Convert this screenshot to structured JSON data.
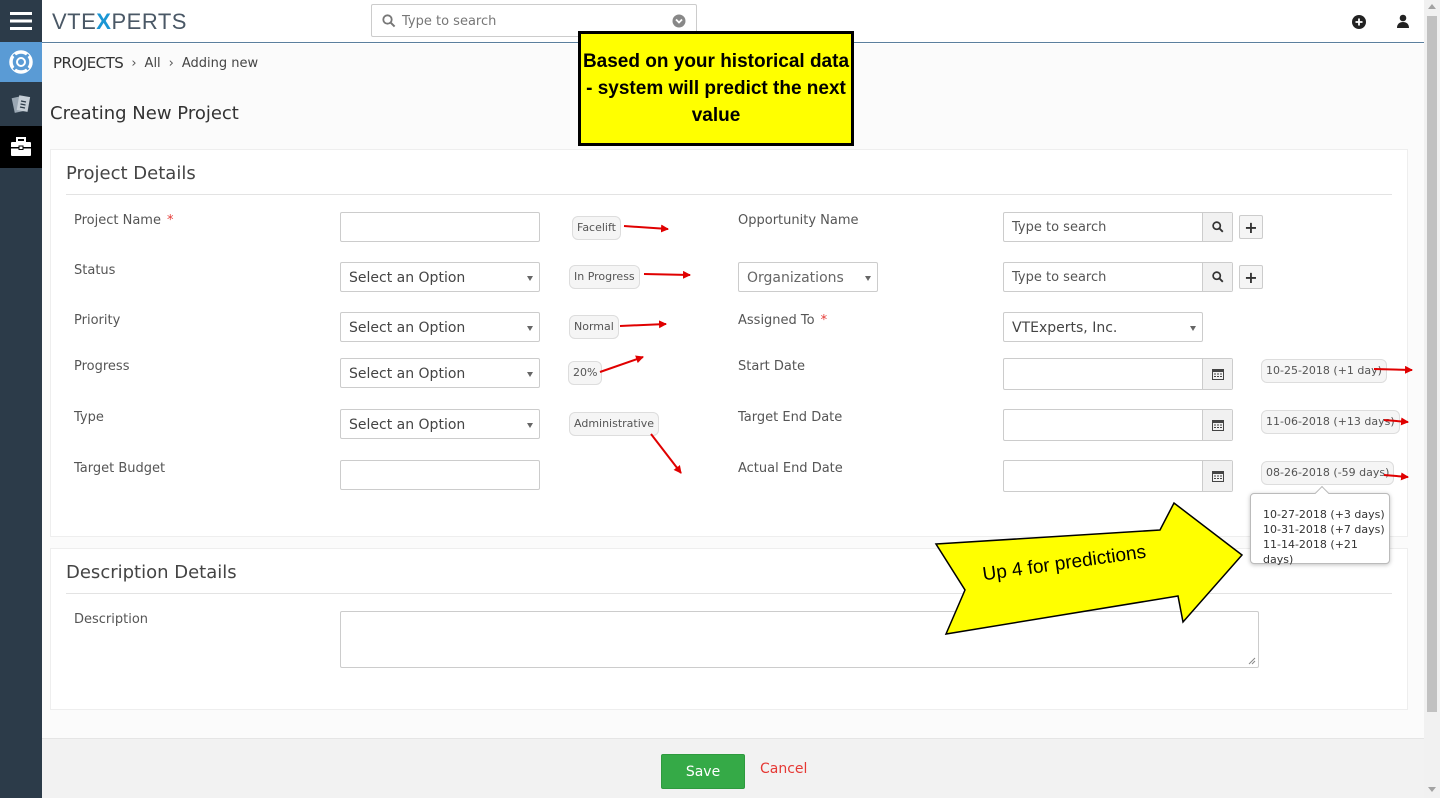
{
  "app": {
    "logo_prefix": "VTE",
    "logo_x": "X",
    "logo_suffix": "PERTS"
  },
  "topbar": {
    "search_placeholder": "Type to search"
  },
  "breadcrumb": {
    "module": "PROJECTS",
    "filter": "All",
    "current": "Adding new"
  },
  "page": {
    "title": "Creating New Project"
  },
  "project_details": {
    "heading": "Project Details",
    "project_name": {
      "label": "Project Name",
      "required": "*",
      "value": "",
      "prediction": "Facelift"
    },
    "status": {
      "label": "Status",
      "value": "Select an Option",
      "prediction": "In Progress"
    },
    "priority": {
      "label": "Priority",
      "value": "Select an Option",
      "prediction": "Normal"
    },
    "progress": {
      "label": "Progress",
      "value": "Select an Option",
      "prediction": "20%"
    },
    "type": {
      "label": "Type",
      "value": "Select an Option",
      "prediction": "Administrative"
    },
    "target_budget": {
      "label": "Target Budget",
      "value": ""
    },
    "opportunity_name": {
      "label": "Opportunity Name",
      "placeholder": "Type to search"
    },
    "related": {
      "type_value": "Organizations",
      "placeholder": "Type to search"
    },
    "assigned_to": {
      "label": "Assigned To",
      "required": "*",
      "value": "VTExperts, Inc."
    },
    "start_date": {
      "label": "Start Date",
      "value": "",
      "prediction": "10-25-2018 (+1 day)"
    },
    "target_end_date": {
      "label": "Target End Date",
      "value": "",
      "prediction": "11-06-2018 (+13 days)"
    },
    "actual_end_date": {
      "label": "Actual End Date",
      "value": "",
      "prediction": "08-26-2018 (-59 days)"
    }
  },
  "predictions_popup": {
    "items": [
      "10-27-2018 (+3 days)",
      "10-31-2018 (+7 days)",
      "11-14-2018 (+21 days)"
    ]
  },
  "description_details": {
    "heading": "Description Details",
    "description": {
      "label": "Description",
      "value": ""
    }
  },
  "footer": {
    "save_label": "Save",
    "cancel_label": "Cancel"
  },
  "annotations": {
    "callout": "Based on your historical data - system will predict the next value",
    "arrow_text": "Up  4 for predictions"
  },
  "colors": {
    "rail": "#2c3b49",
    "rail_active": "#5a9bd5",
    "save": "#35aa47",
    "cancel": "#e53935",
    "callout_bg": "#ffff00",
    "annotation_arrow": "#e00000"
  },
  "icons": [
    "menu-icon",
    "lifebuoy-icon",
    "documents-icon",
    "briefcase-icon",
    "search-icon",
    "chevron-down-icon",
    "plus-circle-icon",
    "user-icon",
    "calendar-icon",
    "plus-icon"
  ]
}
